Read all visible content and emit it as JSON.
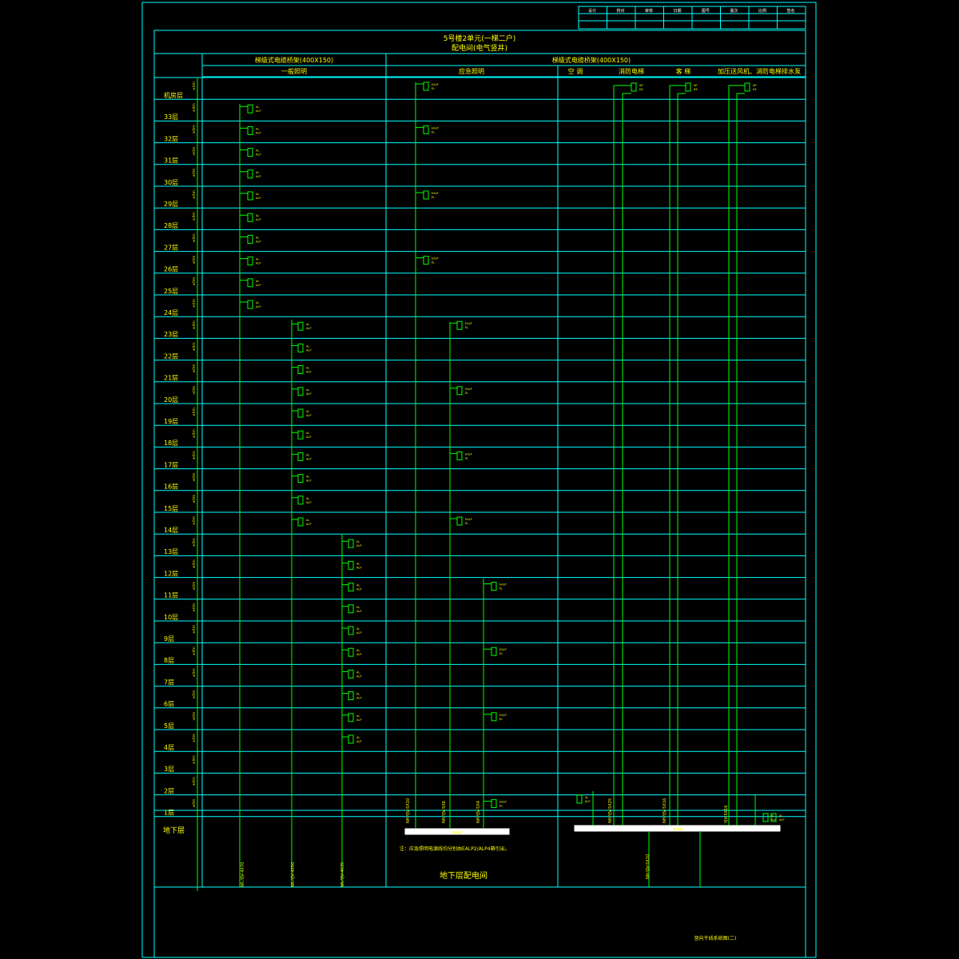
{
  "drawing": {
    "title_line1": "5号楼2单元(一梯二户)",
    "title_line2": "配电间(电气竖井)",
    "cable_tray_left": "梯级式电缆桥架(400X150)",
    "cable_tray_right": "梯级式电缆桥架(400X150)",
    "col_general_lighting": "一般照明",
    "col_emergency_lighting": "应急照明",
    "col_ac": "空  调",
    "col_fire_elevator": "消防电梯",
    "col_passenger_elevator": "客  梯",
    "col_pressurization": "加压送风机、消防电梯排水泵",
    "basement_label": "地下层",
    "basement_room": "地下层配电间",
    "note": "注：应急照明电源线均分别由EALP2/ALP4箱引出。",
    "drawing_title": "竖向干线系统图(二)"
  },
  "floors": [
    "机房层",
    "33层",
    "32层",
    "31层",
    "30层",
    "29层",
    "28层",
    "27层",
    "26层",
    "25层",
    "24层",
    "23层",
    "22层",
    "21层",
    "20层",
    "19层",
    "18层",
    "17层",
    "16层",
    "15层",
    "14层",
    "13层",
    "12层",
    "11层",
    "10层",
    "9层",
    "8层",
    "7层",
    "6层",
    "5层",
    "4层",
    "3层",
    "2层",
    "1层"
  ],
  "floor_height_tag": "±0m",
  "box_label": "AL",
  "box_sublabel": "ALP",
  "em_box_label": "EALP",
  "em_box_sublabel": "EL",
  "roof_box_label": "AP",
  "roof_box_sublabel": "KX",
  "basement_panel_left": "配电箱",
  "basement_panel_right": "配电箱",
  "cable_labels": [
    "WL-YJV-4X70",
    "WL-YJV-4X50",
    "WL-YJV-4X35",
    "NH-YJV-5X10",
    "NH-YJV-5X6",
    "NH-YJV-5X4",
    "NH-YJV-5X25",
    "NH-YJV-5X16",
    "YJV-5X16",
    "NH-YJV-5X10"
  ],
  "title_block": [
    "设计",
    "校对",
    "审核",
    "日期",
    "图号",
    "版次",
    "比例",
    "签名"
  ]
}
